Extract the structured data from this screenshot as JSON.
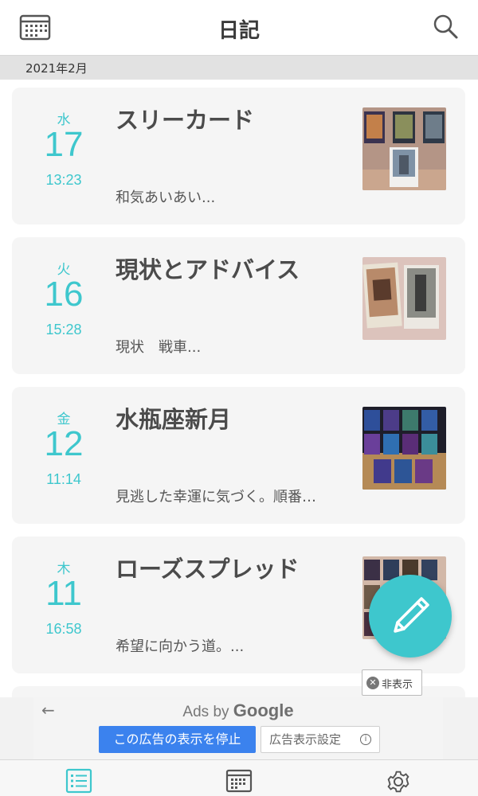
{
  "header": {
    "title": "日記",
    "left_icon": "calendar-icon",
    "right_icon": "search-icon"
  },
  "month_label": "2021年2月",
  "entries": [
    {
      "dow": "水",
      "day": "17",
      "time": "13:23",
      "title": "スリーカード",
      "excerpt": "和気あいあい..."
    },
    {
      "dow": "火",
      "day": "16",
      "time": "15:28",
      "title": "現状とアドバイス",
      "excerpt": "現状　戦車..."
    },
    {
      "dow": "金",
      "day": "12",
      "time": "11:14",
      "title": "水瓶座新月",
      "excerpt": "見逃した幸運に気づく。順番…"
    },
    {
      "dow": "木",
      "day": "11",
      "time": "16:58",
      "title": "ローズスプレッド",
      "excerpt": "希望に向かう道。..."
    }
  ],
  "fab": {
    "icon": "pencil-icon"
  },
  "ad": {
    "ads_by": "Ads by",
    "google": "Google",
    "stop_label": "この広告の表示を停止",
    "settings_label": "広告表示設定",
    "hide_label": "非表示"
  },
  "tabbar": {
    "icons": [
      "list-icon",
      "calendar-icon",
      "gear-icon"
    ],
    "active": "list-icon"
  },
  "colors": {
    "accent": "#3ec7cd",
    "ad_button": "#3b82ee",
    "month_bar": "#e2e2e2"
  }
}
